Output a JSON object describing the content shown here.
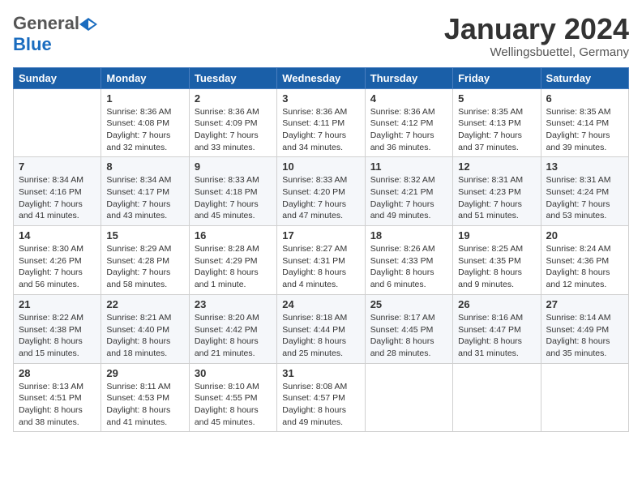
{
  "header": {
    "logo_general": "General",
    "logo_blue": "Blue",
    "month_title": "January 2024",
    "location": "Wellingsbuettel, Germany"
  },
  "weekdays": [
    "Sunday",
    "Monday",
    "Tuesday",
    "Wednesday",
    "Thursday",
    "Friday",
    "Saturday"
  ],
  "weeks": [
    [
      {
        "day": "",
        "info": ""
      },
      {
        "day": "1",
        "info": "Sunrise: 8:36 AM\nSunset: 4:08 PM\nDaylight: 7 hours\nand 32 minutes."
      },
      {
        "day": "2",
        "info": "Sunrise: 8:36 AM\nSunset: 4:09 PM\nDaylight: 7 hours\nand 33 minutes."
      },
      {
        "day": "3",
        "info": "Sunrise: 8:36 AM\nSunset: 4:11 PM\nDaylight: 7 hours\nand 34 minutes."
      },
      {
        "day": "4",
        "info": "Sunrise: 8:36 AM\nSunset: 4:12 PM\nDaylight: 7 hours\nand 36 minutes."
      },
      {
        "day": "5",
        "info": "Sunrise: 8:35 AM\nSunset: 4:13 PM\nDaylight: 7 hours\nand 37 minutes."
      },
      {
        "day": "6",
        "info": "Sunrise: 8:35 AM\nSunset: 4:14 PM\nDaylight: 7 hours\nand 39 minutes."
      }
    ],
    [
      {
        "day": "7",
        "info": "Sunrise: 8:34 AM\nSunset: 4:16 PM\nDaylight: 7 hours\nand 41 minutes."
      },
      {
        "day": "8",
        "info": "Sunrise: 8:34 AM\nSunset: 4:17 PM\nDaylight: 7 hours\nand 43 minutes."
      },
      {
        "day": "9",
        "info": "Sunrise: 8:33 AM\nSunset: 4:18 PM\nDaylight: 7 hours\nand 45 minutes."
      },
      {
        "day": "10",
        "info": "Sunrise: 8:33 AM\nSunset: 4:20 PM\nDaylight: 7 hours\nand 47 minutes."
      },
      {
        "day": "11",
        "info": "Sunrise: 8:32 AM\nSunset: 4:21 PM\nDaylight: 7 hours\nand 49 minutes."
      },
      {
        "day": "12",
        "info": "Sunrise: 8:31 AM\nSunset: 4:23 PM\nDaylight: 7 hours\nand 51 minutes."
      },
      {
        "day": "13",
        "info": "Sunrise: 8:31 AM\nSunset: 4:24 PM\nDaylight: 7 hours\nand 53 minutes."
      }
    ],
    [
      {
        "day": "14",
        "info": "Sunrise: 8:30 AM\nSunset: 4:26 PM\nDaylight: 7 hours\nand 56 minutes."
      },
      {
        "day": "15",
        "info": "Sunrise: 8:29 AM\nSunset: 4:28 PM\nDaylight: 7 hours\nand 58 minutes."
      },
      {
        "day": "16",
        "info": "Sunrise: 8:28 AM\nSunset: 4:29 PM\nDaylight: 8 hours\nand 1 minute."
      },
      {
        "day": "17",
        "info": "Sunrise: 8:27 AM\nSunset: 4:31 PM\nDaylight: 8 hours\nand 4 minutes."
      },
      {
        "day": "18",
        "info": "Sunrise: 8:26 AM\nSunset: 4:33 PM\nDaylight: 8 hours\nand 6 minutes."
      },
      {
        "day": "19",
        "info": "Sunrise: 8:25 AM\nSunset: 4:35 PM\nDaylight: 8 hours\nand 9 minutes."
      },
      {
        "day": "20",
        "info": "Sunrise: 8:24 AM\nSunset: 4:36 PM\nDaylight: 8 hours\nand 12 minutes."
      }
    ],
    [
      {
        "day": "21",
        "info": "Sunrise: 8:22 AM\nSunset: 4:38 PM\nDaylight: 8 hours\nand 15 minutes."
      },
      {
        "day": "22",
        "info": "Sunrise: 8:21 AM\nSunset: 4:40 PM\nDaylight: 8 hours\nand 18 minutes."
      },
      {
        "day": "23",
        "info": "Sunrise: 8:20 AM\nSunset: 4:42 PM\nDaylight: 8 hours\nand 21 minutes."
      },
      {
        "day": "24",
        "info": "Sunrise: 8:18 AM\nSunset: 4:44 PM\nDaylight: 8 hours\nand 25 minutes."
      },
      {
        "day": "25",
        "info": "Sunrise: 8:17 AM\nSunset: 4:45 PM\nDaylight: 8 hours\nand 28 minutes."
      },
      {
        "day": "26",
        "info": "Sunrise: 8:16 AM\nSunset: 4:47 PM\nDaylight: 8 hours\nand 31 minutes."
      },
      {
        "day": "27",
        "info": "Sunrise: 8:14 AM\nSunset: 4:49 PM\nDaylight: 8 hours\nand 35 minutes."
      }
    ],
    [
      {
        "day": "28",
        "info": "Sunrise: 8:13 AM\nSunset: 4:51 PM\nDaylight: 8 hours\nand 38 minutes."
      },
      {
        "day": "29",
        "info": "Sunrise: 8:11 AM\nSunset: 4:53 PM\nDaylight: 8 hours\nand 41 minutes."
      },
      {
        "day": "30",
        "info": "Sunrise: 8:10 AM\nSunset: 4:55 PM\nDaylight: 8 hours\nand 45 minutes."
      },
      {
        "day": "31",
        "info": "Sunrise: 8:08 AM\nSunset: 4:57 PM\nDaylight: 8 hours\nand 49 minutes."
      },
      {
        "day": "",
        "info": ""
      },
      {
        "day": "",
        "info": ""
      },
      {
        "day": "",
        "info": ""
      }
    ]
  ]
}
